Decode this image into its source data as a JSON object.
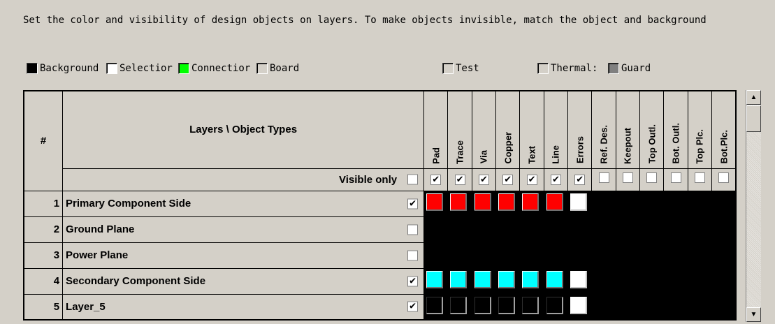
{
  "description": "Set the color and visibility of design objects on layers. To make objects invisible, match the object and background",
  "swatches": [
    {
      "label": "Background",
      "color": "#000000"
    },
    {
      "label": "Selectior",
      "color": "#ffffff"
    },
    {
      "label": "Connectior",
      "color": "#00ff00"
    },
    {
      "label": "Board",
      "color": "#d4d0c8"
    },
    {
      "label": "Test",
      "color": "#d4d0c8"
    },
    {
      "label": "Thermal:",
      "color": "#d4d0c8"
    },
    {
      "label": "Guard",
      "color": "#808080"
    }
  ],
  "grid": {
    "num_header": "#",
    "title_header": "Layers \\ Object Types",
    "visible_only_label": "Visible only",
    "visible_only_checked": false,
    "columns": [
      {
        "label": "Pad",
        "visible": true
      },
      {
        "label": "Trace",
        "visible": true
      },
      {
        "label": "Via",
        "visible": true
      },
      {
        "label": "Copper",
        "visible": true
      },
      {
        "label": "Text",
        "visible": true
      },
      {
        "label": "Line",
        "visible": true
      },
      {
        "label": "Errors",
        "visible": true
      },
      {
        "label": "Ref. Des.",
        "visible": false
      },
      {
        "label": "Keepout",
        "visible": false
      },
      {
        "label": "Top Outl.",
        "visible": false
      },
      {
        "label": "Bot. Outl.",
        "visible": false
      },
      {
        "label": "Top Plc.",
        "visible": false
      },
      {
        "label": "Bot.Plc.",
        "visible": false
      }
    ],
    "rows": [
      {
        "num": "1",
        "name": "Primary Component Side",
        "visible": true,
        "cells": [
          "red",
          "red",
          "red",
          "red",
          "red",
          "red",
          "white",
          "none",
          "none",
          "none",
          "none",
          "none",
          "none"
        ]
      },
      {
        "num": "2",
        "name": "Ground Plane",
        "visible": false,
        "cells": [
          "none",
          "none",
          "none",
          "none",
          "none",
          "none",
          "none",
          "none",
          "none",
          "none",
          "none",
          "none",
          "none"
        ]
      },
      {
        "num": "3",
        "name": "Power Plane",
        "visible": false,
        "cells": [
          "none",
          "none",
          "none",
          "none",
          "none",
          "none",
          "none",
          "none",
          "none",
          "none",
          "none",
          "none",
          "none"
        ]
      },
      {
        "num": "4",
        "name": "Secondary Component Side",
        "visible": true,
        "cells": [
          "cyan",
          "cyan",
          "cyan",
          "cyan",
          "cyan",
          "cyan",
          "white",
          "none",
          "none",
          "none",
          "none",
          "none",
          "none"
        ]
      },
      {
        "num": "5",
        "name": "Layer_5",
        "visible": true,
        "cells": [
          "dark",
          "dark",
          "dark",
          "dark",
          "dark",
          "dark",
          "white",
          "none",
          "none",
          "none",
          "none",
          "none",
          "none"
        ]
      }
    ]
  },
  "scrollbar": {
    "up_icon": "arrow-up-icon",
    "down_icon": "arrow-down-icon"
  }
}
